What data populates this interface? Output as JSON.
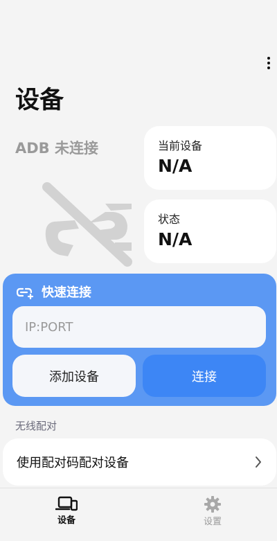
{
  "header": {
    "title": "设备",
    "menu_icon": "more-vert-icon"
  },
  "adb": {
    "status_text": "ADB 未连接",
    "graphic_icon": "link-off-icon"
  },
  "info_cards": {
    "current_device": {
      "label": "当前设备",
      "value": "N/A"
    },
    "state": {
      "label": "状态",
      "value": "N/A"
    }
  },
  "quick_connect": {
    "icon": "link-add-icon",
    "title": "快速连接",
    "input_placeholder": "IP:PORT",
    "input_value": "",
    "add_button_label": "添加设备",
    "connect_button_label": "连接"
  },
  "wireless": {
    "section_label": "无线配对",
    "pair_item_label": "使用配对码配对设备",
    "chevron_icon": "chevron-right-icon"
  },
  "bottom_nav": {
    "items": [
      {
        "label": "设备",
        "icon": "devices-icon",
        "selected": true
      },
      {
        "label": "设置",
        "icon": "gear-icon",
        "selected": false
      }
    ]
  },
  "colors": {
    "accent": "#3d86f5",
    "panel": "#5b98f3",
    "background": "#f4f4f4",
    "muted_text": "#9a9a9a"
  }
}
